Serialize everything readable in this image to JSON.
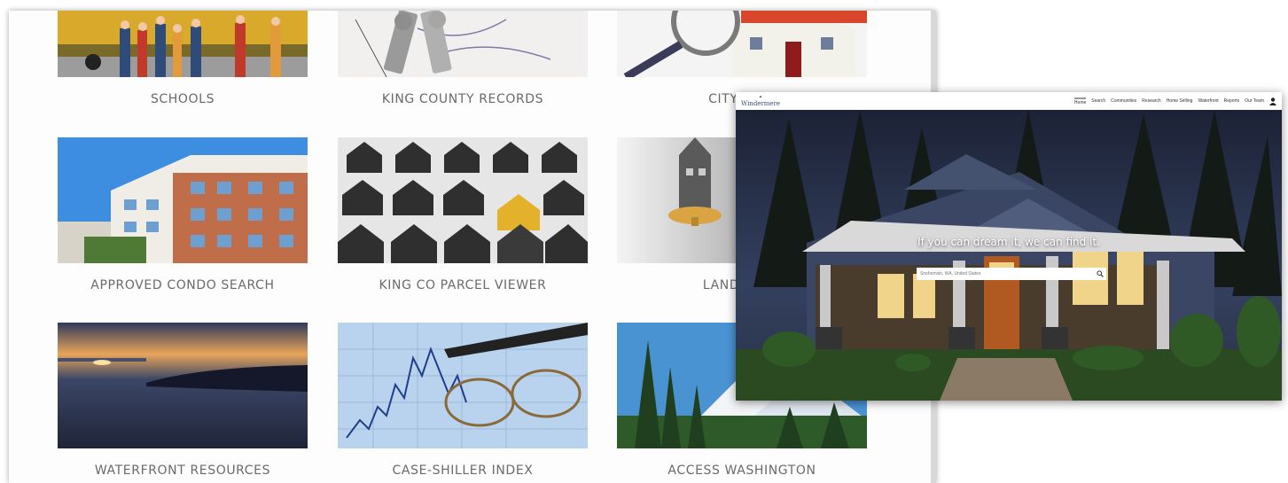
{
  "resources": {
    "tiles": [
      {
        "label": "SCHOOLS",
        "image": "school-bus-children-photo"
      },
      {
        "label": "KING COUNTY RECORDS",
        "image": "house-keys-documents-photo"
      },
      {
        "label": "CITY-DATA",
        "image": "magnifier-house-photo"
      },
      {
        "label": "APPROVED CONDO SEARCH",
        "image": "condo-building-photo"
      },
      {
        "label": "KING CO PARCEL VIEWER",
        "image": "parcel-house-blocks-photo"
      },
      {
        "label": "LANDLORD-",
        "image": "house-key-lock-photo"
      },
      {
        "label": "WATERFRONT RESOURCES",
        "image": "lake-sunset-photo"
      },
      {
        "label": "CASE-SHILLER INDEX",
        "image": "financial-chart-glasses-photo"
      },
      {
        "label": "ACCESS WASHINGTON",
        "image": "mountain-forest-photo"
      }
    ]
  },
  "homepage": {
    "logo": "Windermere",
    "nav": [
      "Home",
      "Search",
      "Communities",
      "Research",
      "Home Selling",
      "Waterfront",
      "Reports",
      "Our Team"
    ],
    "tagline": "If you can dream it, we can find it.",
    "search_placeholder": "Snohomish, WA, United States",
    "icons": {
      "search": "search-icon",
      "user": "user-icon"
    }
  },
  "colors": {
    "label_text": "#6a6a6a",
    "nav_text": "#333333",
    "logo": "#3b4f7a"
  }
}
